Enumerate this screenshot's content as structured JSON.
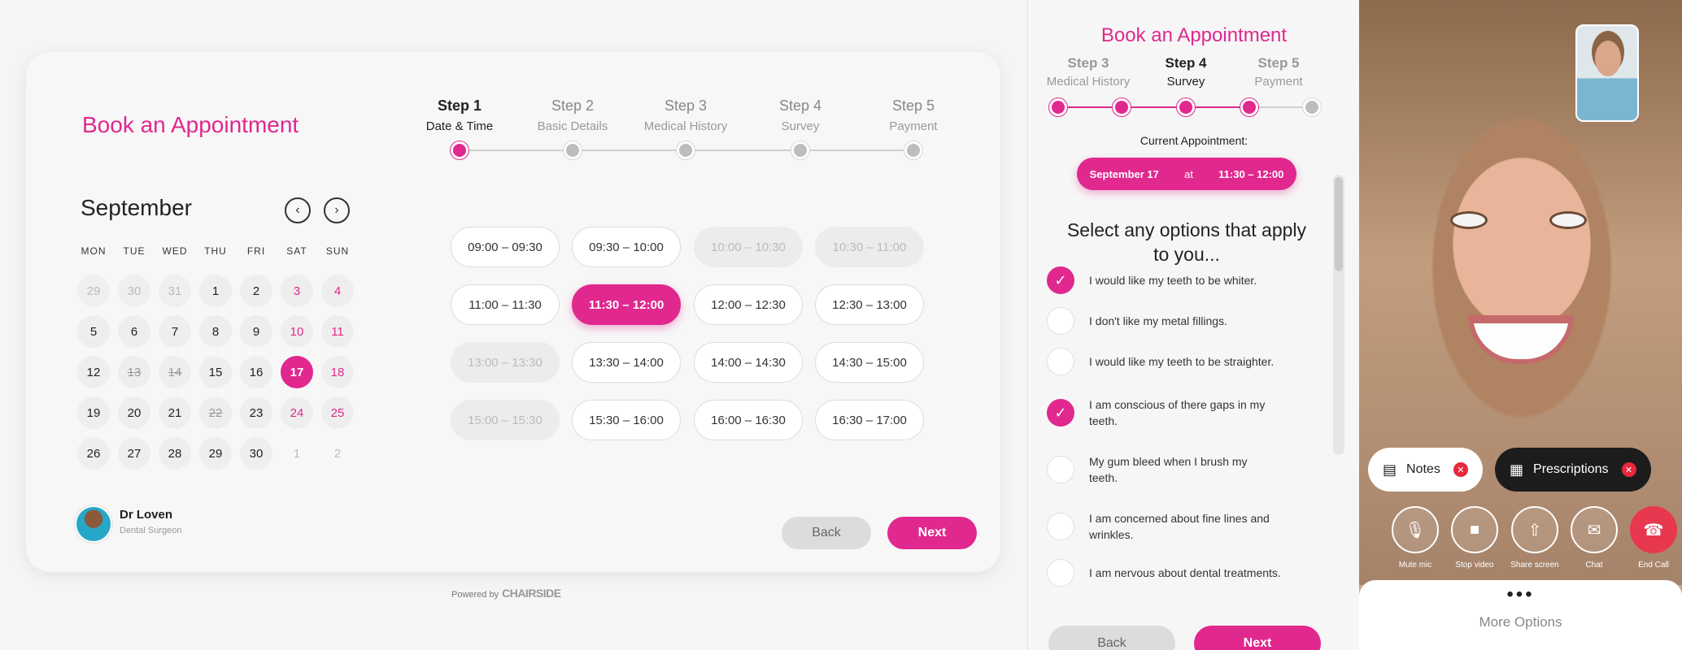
{
  "booking": {
    "title": "Book an Appointment",
    "steps": [
      {
        "num": "Step 1",
        "label": "Date & Time"
      },
      {
        "num": "Step 2",
        "label": "Basic Details"
      },
      {
        "num": "Step 3",
        "label": "Medical History"
      },
      {
        "num": "Step 4",
        "label": "Survey"
      },
      {
        "num": "Step 5",
        "label": "Payment"
      }
    ],
    "month": "September",
    "prev_icon": "chevron-left-icon",
    "next_icon": "chevron-right-icon",
    "weekdays": [
      "MON",
      "TUE",
      "WED",
      "THU",
      "FRI",
      "SAT",
      "SUN"
    ],
    "days": [
      [
        "29",
        "30",
        "31",
        "1",
        "2",
        "3",
        "4"
      ],
      [
        "5",
        "6",
        "7",
        "8",
        "9",
        "10",
        "11"
      ],
      [
        "12",
        "13",
        "14",
        "15",
        "16",
        "17",
        "18"
      ],
      [
        "19",
        "20",
        "21",
        "22",
        "23",
        "24",
        "25"
      ],
      [
        "26",
        "27",
        "28",
        "29",
        "30",
        "1",
        "2"
      ]
    ],
    "selected_day": "17",
    "slots": [
      "09:00  –  09:30",
      "09:30  –  10:00",
      "10:00  –  10:30",
      "10:30  –  11:00",
      "11:00  –  11:30",
      "11:30  –  12:00",
      "12:00  –  12:30",
      "12:30  –  13:00",
      "13:00  –  13:30",
      "13:30  –  14:00",
      "14:00  –  14:30",
      "14:30  –  15:00",
      "15:00  –  15:30",
      "15:30  –  16:00",
      "16:00  –  16:30",
      "16:30  –  17:00"
    ],
    "doctor": {
      "name": "Dr Loven",
      "role": "Dental Surgeon"
    },
    "back_label": "Back",
    "next_label": "Next",
    "powered_by": "Powered by",
    "brand": "CHAIRSIDE"
  },
  "survey": {
    "title": "Book an Appointment",
    "steps": [
      {
        "num": "Step 3",
        "label": "Medical History"
      },
      {
        "num": "Step 4",
        "label": "Survey"
      },
      {
        "num": "Step 5",
        "label": "Payment"
      }
    ],
    "current_label": "Current Appointment:",
    "current_date": "September 17",
    "current_at": "at",
    "current_time": "11:30  –  12:00",
    "question": "Select any options that apply to you...",
    "options": [
      {
        "text": "I would like my teeth to be whiter.",
        "checked": true
      },
      {
        "text": "I don't like my metal fillings.",
        "checked": false
      },
      {
        "text": "I would like my teeth to be straighter.",
        "checked": false
      },
      {
        "text": "I am conscious of there gaps in my teeth.",
        "checked": true
      },
      {
        "text": "My gum bleed when I brush my teeth.",
        "checked": false
      },
      {
        "text": "I am concerned about fine lines and wrinkles.",
        "checked": false
      },
      {
        "text": "I am nervous about dental treatments.",
        "checked": false
      }
    ],
    "back_label": "Back",
    "next_label": "Next"
  },
  "call": {
    "notes_label": "Notes",
    "prescriptions_label": "Prescriptions",
    "controls": [
      {
        "icon": "microphone-icon",
        "label": "Mute mic"
      },
      {
        "icon": "video-camera-icon",
        "label": "Stop video"
      },
      {
        "icon": "share-screen-icon",
        "label": "Share screen"
      },
      {
        "icon": "chat-icon",
        "label": "Chat"
      },
      {
        "icon": "end-call-icon",
        "label": "End Call"
      }
    ],
    "more_label": "More Options",
    "end_call_color": "#e8384f"
  },
  "colors": {
    "accent": "#e0288e",
    "muted": "#bdbdbd"
  }
}
